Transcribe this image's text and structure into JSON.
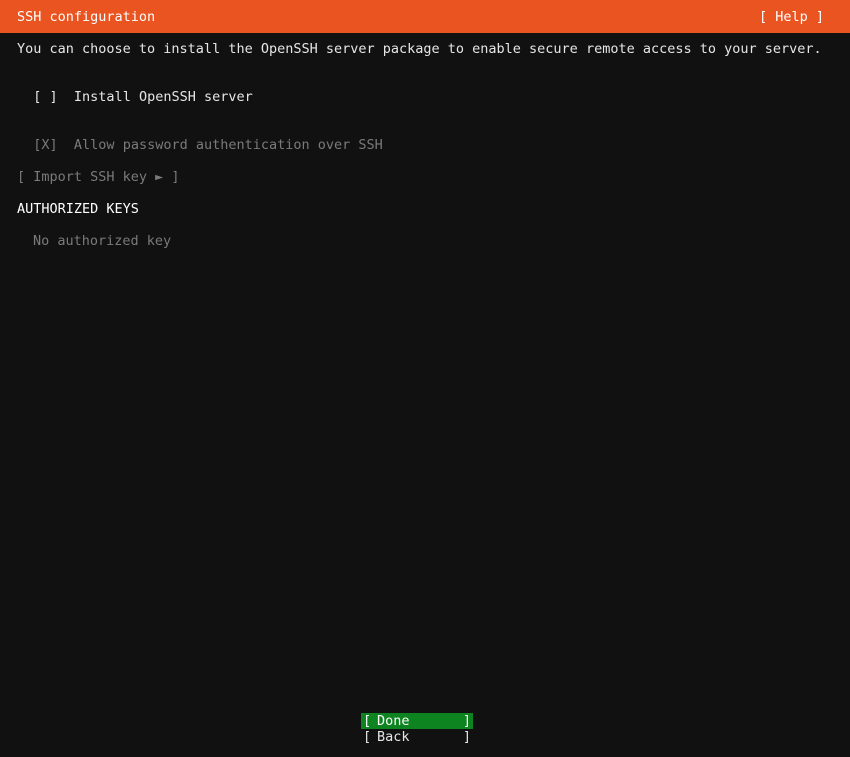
{
  "header": {
    "title": "SSH configuration",
    "help_label": "[ Help ]"
  },
  "description": "You can choose to install the OpenSSH server package to enable secure remote access to your server.",
  "install_openssh": {
    "checkbox": "[ ]",
    "label": "Install OpenSSH server",
    "checked": false
  },
  "allow_password": {
    "checkbox": "[X]",
    "label": "Allow password authentication over SSH",
    "checked": true,
    "disabled": true
  },
  "import_key": {
    "label": "[ Import SSH key ► ]",
    "disabled": true
  },
  "authorized_keys": {
    "title": "AUTHORIZED KEYS",
    "empty_text": "No authorized key"
  },
  "footer": {
    "done": {
      "open": "[",
      "label": "Done",
      "close": "]"
    },
    "back": {
      "open": "[",
      "label": "Back",
      "close": "]"
    }
  },
  "colors": {
    "header_bg": "#e95420",
    "background": "#111111",
    "done_bg": "#0e8420",
    "text": "#e6e6e6",
    "disabled_text": "#7a7a7a"
  }
}
